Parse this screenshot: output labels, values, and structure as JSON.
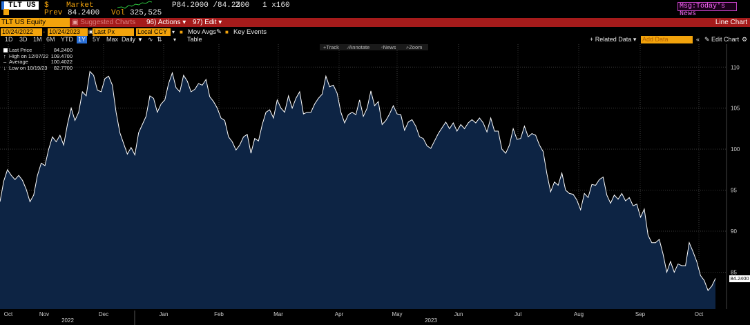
{
  "quote": {
    "ticker": "TLT US",
    "currency": "$",
    "status": "Market",
    "bid_ask": "P84.2000 /84.2300",
    "ask_flag": "Z",
    "size": "1 x160",
    "prev_label": "Prev",
    "prev_value": "84.2400",
    "vol_label": "Vol",
    "vol_value": "325,525",
    "msg": "Msg:Today's News"
  },
  "function_bar": {
    "security": "TLT US Equity",
    "suggested": "Suggested Charts",
    "actions_num": "96)",
    "actions": "Actions",
    "edit_num": "97)",
    "edit": "Edit",
    "chart_type": "Line Chart"
  },
  "settings": {
    "start_date": "10/24/2022",
    "end_date": "10/24/2023",
    "field": "Last Px",
    "currency": "Local CCY",
    "mov_avgs": "Mov Avgs",
    "key_events": "Key Events"
  },
  "ranges": [
    "1D",
    "3D",
    "1M",
    "6M",
    "YTD",
    "1Y",
    "5Y",
    "Max"
  ],
  "selected_range": "1Y",
  "periodicity": "Daily",
  "table_label": "Table",
  "related_data": "Related Data",
  "add_data": "Add Data",
  "edit_chart": "Edit Chart",
  "chart_tools": {
    "track": "Track",
    "annotate": "Annotate",
    "news": "News",
    "zoom": "Zoom"
  },
  "legend": [
    {
      "label": "Last Price",
      "value": "84.2400"
    },
    {
      "label": "High on 12/07/22",
      "value": "109.4700"
    },
    {
      "label": "Average",
      "value": "100.4022"
    },
    {
      "label": "Low on 10/19/23",
      "value": "82.7700"
    }
  ],
  "last_tag": "84.2400",
  "colors": {
    "accent_orange": "#f2a30c",
    "function_red": "#a51b1b",
    "area_fill": "#0d2444",
    "line": "#ffffff",
    "selected_blue": "#2a6fd6"
  },
  "chart_data": {
    "type": "area",
    "y_ticks": [
      85,
      90,
      95,
      100,
      105,
      110
    ],
    "ylim": [
      80.5,
      112.8
    ],
    "x_months": [
      "Oct",
      "Nov",
      "Dec",
      "Jan",
      "Feb",
      "Mar",
      "Apr",
      "May",
      "Jun",
      "Jul",
      "Aug",
      "Sep",
      "Oct"
    ],
    "x_years": [
      "2022",
      "2023"
    ],
    "grid": true,
    "series": [
      {
        "values": [
          93.6,
          96.1,
          97.5,
          96.8,
          96.3,
          96.8,
          96.2,
          95.1,
          93.6,
          94.4,
          96.8,
          98.3,
          98.0,
          100.0,
          101.5,
          100.9,
          101.7,
          100.5,
          103.0,
          105.0,
          103.5,
          104.5,
          107.0,
          106.5,
          109.47,
          109.0,
          107.2,
          107.0,
          108.6,
          108.9,
          107.8,
          104.5,
          102.0,
          100.7,
          99.4,
          100.2,
          99.3,
          102.0,
          103.0,
          104.0,
          106.5,
          106.2,
          104.5,
          105.5,
          106.0,
          108.0,
          109.3,
          107.5,
          107.0,
          109.0,
          108.3,
          107.0,
          107.3,
          108.0,
          107.8,
          108.5,
          106.4,
          105.8,
          105.0,
          103.8,
          103.5,
          101.5,
          100.9,
          99.9,
          100.5,
          101.5,
          101.8,
          99.5,
          101.3,
          101.0,
          103.0,
          104.5,
          104.8,
          103.8,
          106.0,
          105.0,
          104.5,
          106.5,
          105.0,
          106.2,
          107.0,
          104.3,
          104.5,
          104.5,
          105.5,
          106.2,
          106.7,
          108.9,
          107.6,
          107.8,
          106.8,
          104.5,
          103.2,
          104.2,
          104.5,
          104.2,
          106.0,
          104.0,
          105.0,
          107.1,
          105.3,
          105.8,
          103.0,
          103.5,
          104.3,
          105.3,
          104.3,
          104.2,
          102.3,
          103.3,
          103.6,
          102.8,
          101.5,
          101.3,
          100.4,
          100.1,
          101.0,
          101.9,
          102.6,
          103.3,
          102.5,
          103.2,
          102.2,
          103.0,
          102.5,
          103.2,
          103.6,
          103.2,
          103.8,
          103.2,
          102.1,
          103.8,
          102.2,
          102.2,
          100.0,
          99.5,
          100.5,
          102.5,
          101.2,
          101.3,
          102.8,
          101.5,
          101.9,
          101.7,
          100.5,
          99.7,
          97.0,
          94.8,
          96.0,
          95.6,
          97.1,
          95.0,
          94.6,
          94.5,
          93.8,
          92.6,
          94.6,
          94.1,
          95.7,
          95.6,
          96.3,
          96.6,
          94.4,
          93.4,
          94.4,
          93.9,
          94.6,
          93.7,
          94.1,
          93.1,
          93.3,
          91.7,
          92.7,
          89.5,
          88.6,
          88.6,
          89.0,
          87.2,
          85.0,
          86.3,
          85.0,
          86.0,
          85.8,
          85.8,
          88.6,
          87.5,
          86.3,
          84.6,
          84.0,
          82.77,
          83.3,
          84.24
        ]
      }
    ]
  }
}
